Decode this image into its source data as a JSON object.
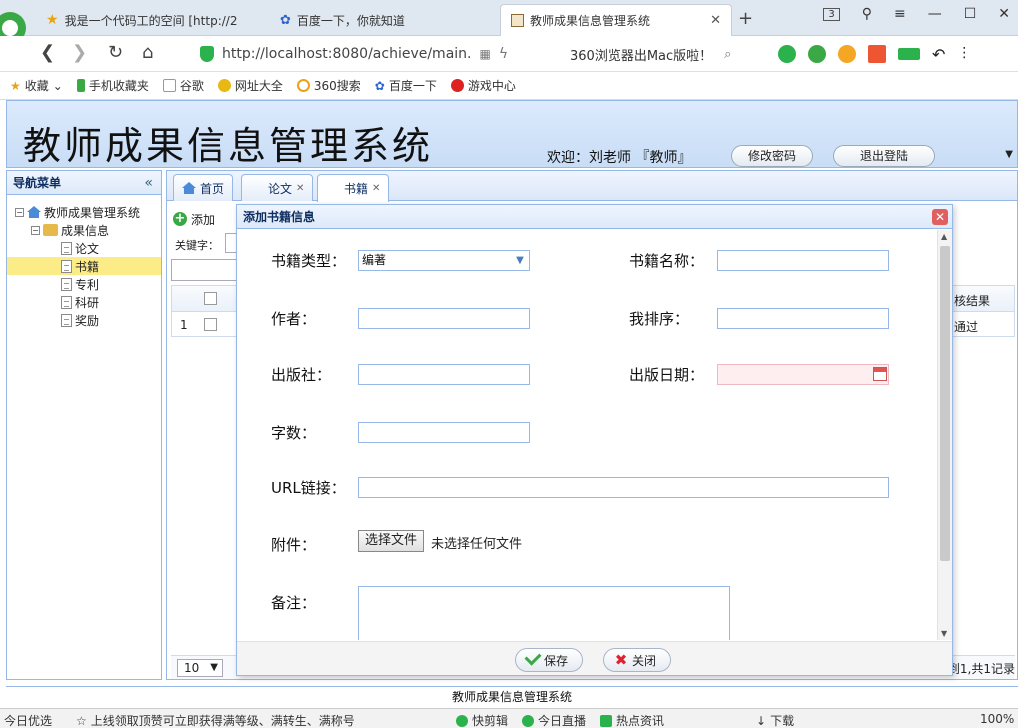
{
  "browser": {
    "tabs": [
      {
        "title": "我是一个代码工的空间 [http://2",
        "active": false
      },
      {
        "title": "百度一下，你就知道",
        "active": false
      },
      {
        "title": "教师成果信息管理系统",
        "active": true
      }
    ],
    "tab_count": "3",
    "url": "http://localhost:8080/achieve/main.",
    "search_text": "360浏览器出Mac版啦！",
    "bookmarks": [
      "收藏",
      "手机收藏夹",
      "谷歌",
      "网址大全",
      "360搜索",
      "百度一下",
      "游戏中心"
    ]
  },
  "app": {
    "title": "教师成果信息管理系统",
    "welcome": "欢迎：刘老师 『教师』",
    "change_password": "修改密码",
    "logout": "退出登陆",
    "footer": "教师成果信息管理系统"
  },
  "nav": {
    "title": "导航菜单",
    "root": "教师成果管理系统",
    "group": "成果信息",
    "items": [
      "论文",
      "书籍",
      "专利",
      "科研",
      "奖励"
    ],
    "selected": "书籍"
  },
  "center": {
    "tabs": [
      "首页",
      "论文",
      "书籍"
    ],
    "add_label": "添加",
    "keyword_label": "关键字：",
    "row_number": "1",
    "result_header": "核结果",
    "result_value": "通过",
    "page_size": "10",
    "pager_info": "到1,共1记录"
  },
  "dialog": {
    "title": "添加书籍信息",
    "fields": {
      "book_type": {
        "label": "书籍类型：",
        "value": "编著"
      },
      "book_name": {
        "label": "书籍名称：",
        "value": ""
      },
      "author": {
        "label": "作者：",
        "value": ""
      },
      "rank": {
        "label": "我排序：",
        "value": ""
      },
      "publisher": {
        "label": "出版社：",
        "value": ""
      },
      "publish_date": {
        "label": "出版日期：",
        "value": ""
      },
      "word_count": {
        "label": "字数：",
        "value": ""
      },
      "url": {
        "label": "URL链接：",
        "value": ""
      },
      "attachment": {
        "label": "附件：",
        "button": "选择文件",
        "status": "未选择任何文件"
      },
      "remark": {
        "label": "备注：",
        "value": ""
      }
    },
    "save": "保存",
    "close": "关闭"
  },
  "statusbar": {
    "left1": "今日优选",
    "left2": "上线领取顶赞可立即获得满等级、满转生、满称号",
    "items": [
      "快剪辑",
      "今日直播",
      "热点资讯"
    ],
    "download": "下载",
    "zoom": "100%"
  }
}
